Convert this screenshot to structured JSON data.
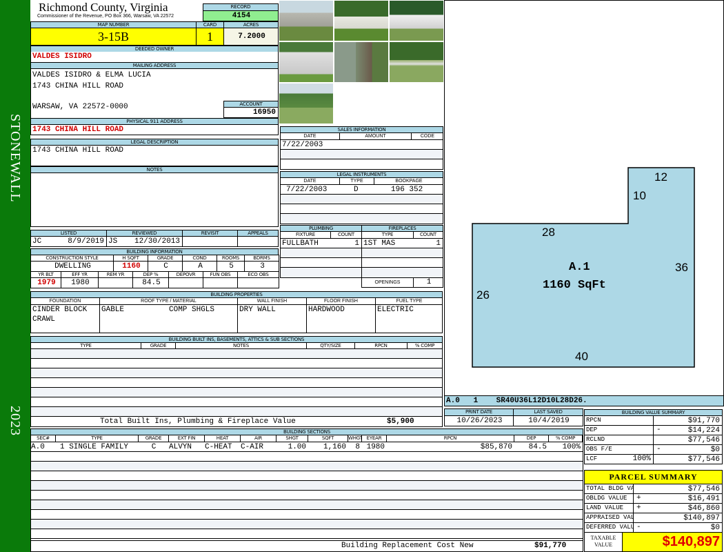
{
  "sidebar": {
    "district": "STONEWALL",
    "year": "2023"
  },
  "header": {
    "title": "Richmond County, Virginia",
    "subtitle": "Commissioner of the Revenue, PO Box 366, Warsaw, VA 22572",
    "record_label": "RECORD",
    "record": "4154"
  },
  "parcel": {
    "map_label": "MAP NUMBER",
    "map": "3-15B",
    "card_label": "CARD",
    "card": "1",
    "acres_label": "ACRES",
    "acres": "7.2000"
  },
  "owner": {
    "label": "DEEDED OWNER",
    "name": "VALDES ISIDRO"
  },
  "mailing": {
    "label": "MAILING ADDRESS",
    "line1": "VALDES ISIDRO & ELMA LUCIA",
    "line2": "1743 CHINA HILL ROAD",
    "line3": "WARSAW, VA 22572-0000",
    "account_label": "ACCOUNT",
    "account": "16950"
  },
  "physical": {
    "label": "PHYSICAL 911 ADDRESS",
    "value": "1743 CHINA HILL ROAD"
  },
  "legal": {
    "label": "LEGAL DESCRIPTION",
    "value": "1743 CHINA HILL ROAD"
  },
  "notes": {
    "label": "NOTES"
  },
  "review": {
    "listed_label": "LISTED",
    "reviewed_label": "REVIEWED",
    "revisit_label": "REVISIT",
    "appeals_label": "APPEALS",
    "listed_by": "JC",
    "listed_date": "8/9/2019",
    "reviewed_by": "JS",
    "reviewed_date": "12/30/2013"
  },
  "building_info": {
    "label": "BUILDING INFORMATION",
    "h1": [
      "CONSTRUCTION STYLE",
      "H SQFT",
      "GRADE",
      "COND",
      "ROOMS",
      "BDRMS"
    ],
    "v1": [
      "DWELLING",
      "1160",
      "C",
      "A",
      "5",
      "3"
    ],
    "h2": [
      "YR BLT",
      "EFF YR",
      "REM YR",
      "DEP %",
      "DEPOVR",
      "FUN OBS",
      "ECO OBS"
    ],
    "v2": [
      "1979",
      "1980",
      "",
      "84.5",
      "",
      "",
      ""
    ]
  },
  "sales": {
    "label": "SALES INFORMATION",
    "cols": [
      "DATE",
      "AMOUNT",
      "CODE"
    ],
    "date": "7/22/2003"
  },
  "instruments": {
    "label": "LEGAL INSTRUMENTS",
    "cols": [
      "DATE",
      "TYPE",
      "BOOKPAGE"
    ],
    "date": "7/22/2003",
    "type": "D",
    "bookpage": "196 352"
  },
  "plumbing": {
    "label": "PLUMBING",
    "cols": [
      "FIXTURE",
      "COUNT"
    ],
    "fixture": "FULLBATH",
    "count": "1"
  },
  "fireplaces": {
    "label": "FIREPLACES",
    "cols": [
      "TYPE",
      "COUNT"
    ],
    "type": "1ST MAS",
    "count": "1",
    "openings_label": "OPENINGS",
    "openings": "1"
  },
  "properties": {
    "label": "BUILDING PROPERTIES",
    "cols": [
      "FOUNDATION",
      "ROOF TYPE / MATERIAL",
      "WALL FINISH",
      "FLOOR FINISH",
      "FUEL TYPE"
    ],
    "foundation1": "CINDER BLOCK",
    "foundation2": "CRAWL",
    "roof_type": "GABLE",
    "roof_material": "COMP SHGLS",
    "wall": "DRY WALL",
    "floor": "HARDWOOD",
    "fuel": "ELECTRIC"
  },
  "builtins": {
    "label": "BUILDING BUILT INS, BASEMENTS, ATTICS & SUB SECTIONS",
    "cols": [
      "TYPE",
      "GRADE",
      "NOTES",
      "QTY/SIZE",
      "RPCN",
      "% COMP"
    ],
    "total_label": "Total Built Ins, Plumbing & Fireplace Value",
    "total": "$5,900"
  },
  "sections": {
    "label": "BUILDING SECTIONS",
    "cols": [
      "SEC#",
      "TYPE",
      "GRADE",
      "EXT FIN",
      "HEAT",
      "AIR",
      "SHGT",
      "SQFT",
      "WHGT",
      "EYEAR",
      "RPCN",
      "DEP",
      "% COMP"
    ],
    "row": [
      "A.0",
      "1 SINGLE FAMILY",
      "C",
      "ALVYN",
      "C-HEAT",
      "C-AIR",
      "1.00",
      "1,160",
      "8",
      "1980",
      "$85,870",
      "84.5",
      "100%"
    ],
    "total_label": "Building Replacement Cost New",
    "total": "$91,770"
  },
  "sketch": {
    "labels": {
      "top": "12",
      "inner": "10",
      "mid": "28",
      "right": "36",
      "left": "26",
      "bottom": "40"
    },
    "area": "A.1",
    "sqft": "1160 SqFt",
    "code": "A.0   1    SR40U36L12D10L28D26."
  },
  "dates": {
    "print_label": "PRINT DATE",
    "print": "10/26/2023",
    "saved_label": "LAST SAVED",
    "saved": "10/4/2019"
  },
  "value_summary": {
    "label": "BUILDING VALUE SUMMARY",
    "rows": [
      {
        "k": "RPCN",
        "s": "",
        "v": "$91,770"
      },
      {
        "k": "DEP",
        "s": "-",
        "v": "$14,224"
      },
      {
        "k": "RCLND",
        "s": "",
        "v": "$77,546"
      },
      {
        "k": "OBS F/E",
        "s": "-",
        "v": "$0"
      },
      {
        "k": "LCF",
        "p": "100%",
        "s": "",
        "v": "$77,546"
      }
    ]
  },
  "parcel_summary": {
    "label": "PARCEL SUMMARY",
    "rows": [
      {
        "k": "TOTAL BLDG VALUE",
        "s": "",
        "v": "$77,546"
      },
      {
        "k": "OBLDG VALUE",
        "s": "+",
        "v": "$16,491"
      },
      {
        "k": "LAND VALUE",
        "s": "+",
        "v": "$46,860"
      },
      {
        "k": "APPRAISED VALUE",
        "s": "",
        "v": "$140,897"
      },
      {
        "k": "DEFERRED VALUE",
        "s": "-",
        "v": "$0"
      }
    ],
    "taxable_label": "TAXABLE VALUE",
    "taxable": "$140,897"
  },
  "colors": {
    "header": "#add8e6",
    "sidebar": "#0a7a0a",
    "highlight": "#ffff00",
    "record": "#90ee90",
    "sketch": "#add8e6"
  }
}
